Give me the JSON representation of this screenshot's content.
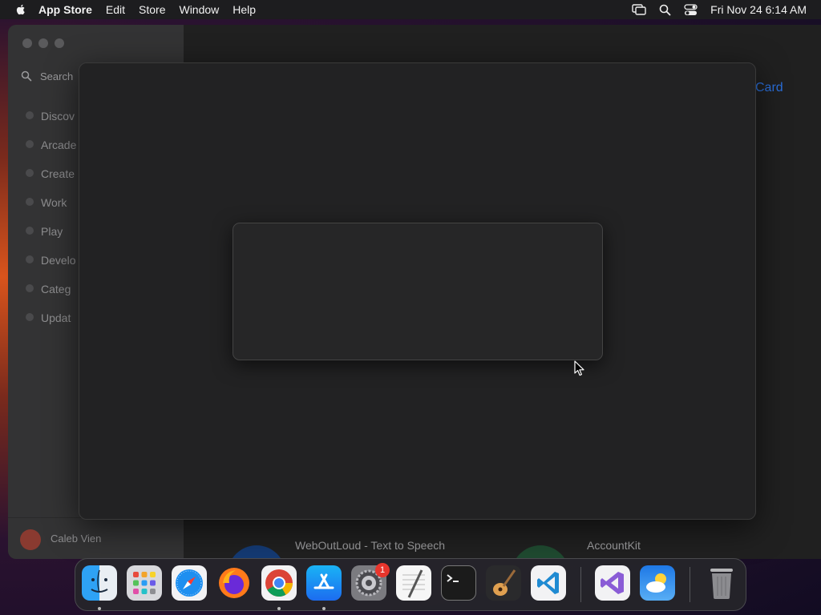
{
  "menubar": {
    "app_name": "App Store",
    "items": [
      "Edit",
      "Store",
      "Window",
      "Help"
    ],
    "clock": "Fri Nov 24  6:14 AM"
  },
  "sidebar": {
    "search_placeholder": "Search",
    "items": [
      {
        "label": "Discov"
      },
      {
        "label": "Arcade"
      },
      {
        "label": "Create"
      },
      {
        "label": "Work"
      },
      {
        "label": "Play"
      },
      {
        "label": "Develo"
      },
      {
        "label": "Categ"
      },
      {
        "label": "Updat"
      }
    ],
    "user_name": "Caleb Vien"
  },
  "content": {
    "gift_link": "Card",
    "apps": [
      {
        "name": "WebOutLoud - Text to Speech"
      },
      {
        "name": "AccountKit"
      }
    ]
  },
  "dock": {
    "items": [
      {
        "name": "Finder",
        "icon": "finder-icon"
      },
      {
        "name": "Launchpad",
        "icon": "launchpad-icon"
      },
      {
        "name": "Safari",
        "icon": "safari-icon"
      },
      {
        "name": "Firefox",
        "icon": "firefox-icon"
      },
      {
        "name": "Google Chrome",
        "icon": "chrome-icon"
      },
      {
        "name": "App Store",
        "icon": "app-store-icon"
      },
      {
        "name": "System Settings",
        "icon": "system-settings-icon",
        "badge": "1"
      },
      {
        "name": "TextEdit",
        "icon": "textedit-icon"
      },
      {
        "name": "Terminal",
        "icon": "terminal-icon"
      },
      {
        "name": "GarageBand",
        "icon": "garageband-icon"
      },
      {
        "name": "Visual Studio Code",
        "icon": "vscode-icon"
      },
      {
        "name": "Visual Studio",
        "icon": "visual-studio-icon"
      },
      {
        "name": "Weather",
        "icon": "weather-icon"
      },
      {
        "name": "Trash",
        "icon": "trash-icon"
      }
    ]
  }
}
